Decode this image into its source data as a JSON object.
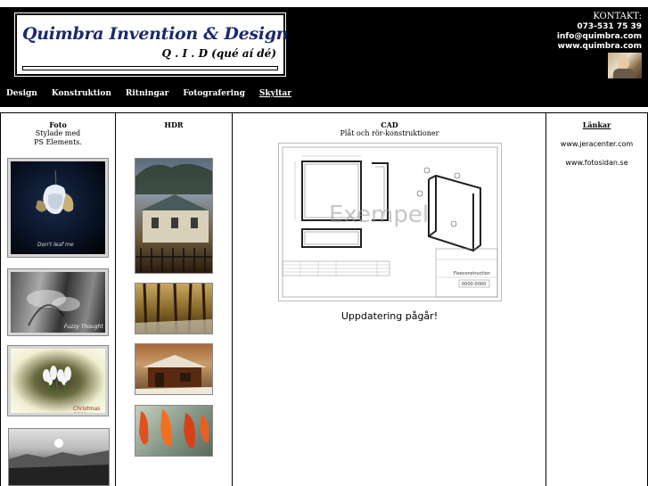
{
  "header": {
    "title": "Quimbra Invention & Design",
    "subtitle": "Q . I . D (qué aí dé)",
    "contact_label": "KONTAKT:",
    "phone": "073-531 75 39",
    "email": "info@quimbra.com",
    "website": "www.quimbra.com"
  },
  "nav": {
    "items": [
      {
        "label": "Design"
      },
      {
        "label": "Konstruktion"
      },
      {
        "label": "Ritningar"
      },
      {
        "label": "Fotografering"
      },
      {
        "label": "Skyltar",
        "active": true
      }
    ]
  },
  "columns": {
    "foto": {
      "title": "Foto",
      "line1": "Stylade med",
      "line2": "PS Elements."
    },
    "hdr": {
      "title": "HDR"
    },
    "cad": {
      "title": "CAD",
      "subtitle": "Plåt och rör-konstruktioner",
      "watermark": "Exempel",
      "status": "Uppdatering pågår!"
    },
    "links": {
      "title": "Länkar",
      "items": [
        "www.jeracenter.com",
        "www.fotosidan.se"
      ]
    }
  },
  "foto_captions": {
    "photo1": "Don't leaf me",
    "photo2": "Fuzzy Thought",
    "photo3": "Christmas 2009"
  },
  "cad_drawing": {
    "title_block": "Fixeconstruction",
    "part_no": "0000-0000"
  }
}
